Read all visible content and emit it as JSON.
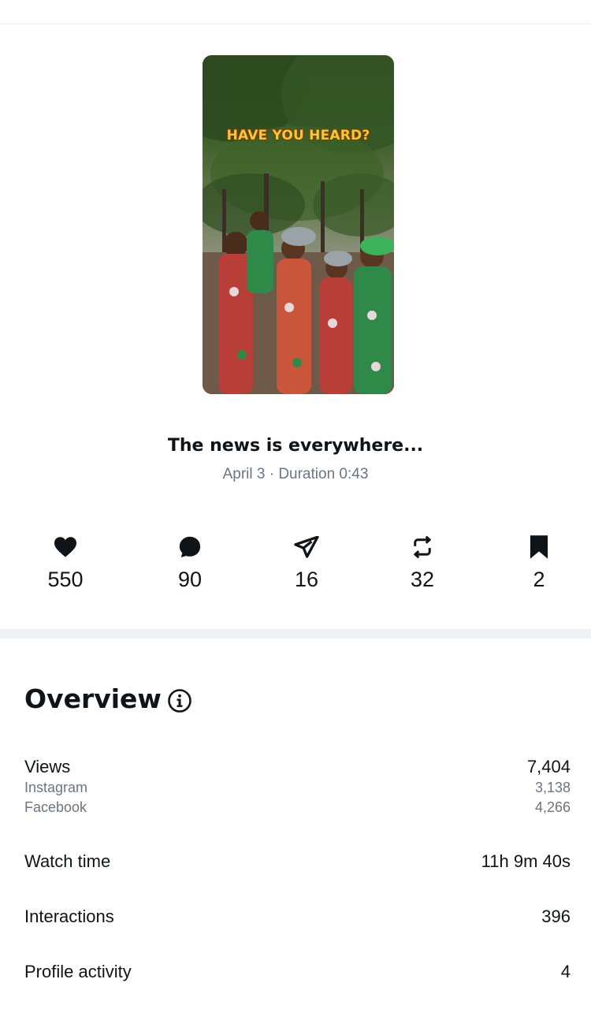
{
  "post": {
    "thumbnail_caption": "HAVE YOU HEARD?",
    "title": "The news is everywhere...",
    "meta": "April 3 · Duration 0:43"
  },
  "engagement": [
    {
      "icon": "heart-icon",
      "value": "550"
    },
    {
      "icon": "comment-icon",
      "value": "90"
    },
    {
      "icon": "share-icon",
      "value": "16"
    },
    {
      "icon": "repost-icon",
      "value": "32"
    },
    {
      "icon": "bookmark-icon",
      "value": "2"
    }
  ],
  "overview": {
    "title": "Overview",
    "views": {
      "label": "Views",
      "value": "7,404",
      "breakdown": [
        {
          "label": "Instagram",
          "value": "3,138"
        },
        {
          "label": "Facebook",
          "value": "4,266"
        }
      ]
    },
    "watch_time": {
      "label": "Watch time",
      "value": "11h 9m 40s"
    },
    "interactions": {
      "label": "Interactions",
      "value": "396"
    },
    "profile_activity": {
      "label": "Profile activity",
      "value": "4"
    }
  },
  "colors": {
    "text": "#0f1419",
    "muted": "#6b7580",
    "divider": "#eef1f4",
    "caption": "#f7c63a"
  }
}
